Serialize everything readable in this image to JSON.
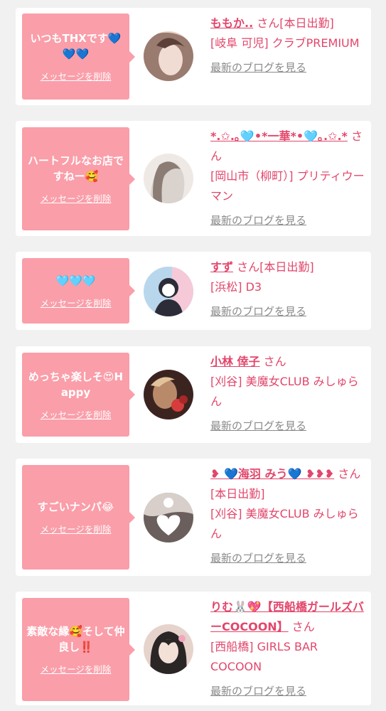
{
  "cards": [
    {
      "message": "いつもTHXです💙💙💙",
      "delete_label": "メッセージを削除",
      "name": "ももか..",
      "suffix": "さん",
      "status": "[本日出勤]",
      "location": "[岐阜 可児] クラブPREMIUM",
      "blog_label": "最新のブログを見る",
      "avatar_colors": [
        "#9a7b70",
        "#e8cfc4",
        "#5a4038"
      ]
    },
    {
      "message": "ハートフルなお店ですねー🥰",
      "delete_label": "メッセージを削除",
      "name": "*.✩.｡🩵•*一華*•🩵｡.✩.*",
      "suffix": "さん",
      "status": "",
      "location": "[岡山市（柳町）] プリティウーマン",
      "blog_label": "最新のブログを見る",
      "avatar_colors": [
        "#d9d2cd",
        "#efe9e5",
        "#8c7d74"
      ]
    },
    {
      "message": "🩵🩵🩵",
      "delete_label": "メッセージを削除",
      "name": "すず",
      "suffix": "さん",
      "status": "[本日出勤]",
      "location": "[浜松] D3",
      "blog_label": "最新のブログを見る",
      "avatar_colors": [
        "#b9d7ec",
        "#f5c9d8",
        "#2c2c38"
      ]
    },
    {
      "message": "めっちゃ楽しそ😍Happy",
      "delete_label": "メッセージを削除",
      "name": "小林 倖子",
      "suffix": "さん",
      "status": "",
      "location": "[刈谷] 美魔女CLUB みしゅらん",
      "blog_label": "最新のブログを見る",
      "avatar_colors": [
        "#3b2420",
        "#b98a6a",
        "#d63c3c"
      ]
    },
    {
      "message": "すごいナンパ😂",
      "delete_label": "メッセージを削除",
      "name": "❥ 💙海羽 みう💙 ❥❥❥",
      "suffix": "さん",
      "status": "[本日出勤]",
      "location": "[刈谷] 美魔女CLUB みしゅらん",
      "blog_label": "最新のブログを見る",
      "avatar_colors": [
        "#6a5f5c",
        "#d8cfcb",
        "#ffffff"
      ]
    },
    {
      "message": "素敵な縁🥰そして仲良し‼️",
      "delete_label": "メッセージを削除",
      "name": "りむ🐰💖【西船橋ガールズバーCOCOON】",
      "suffix": "さん",
      "status": "",
      "location": "[西船橋] GIRLS BAR COCOON",
      "blog_label": "最新のブログを見る",
      "avatar_colors": [
        "#2a2626",
        "#e6d3cc",
        "#f2a6bd"
      ]
    }
  ]
}
